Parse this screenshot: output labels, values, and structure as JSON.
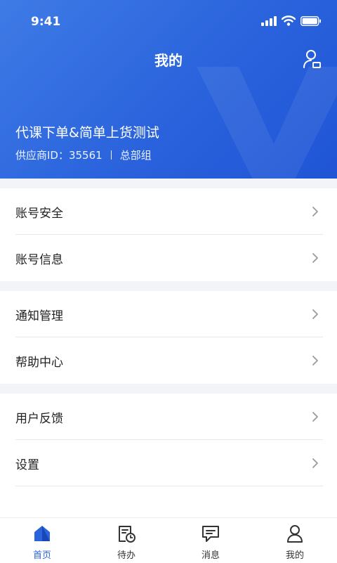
{
  "status_bar": {
    "time": "9:41"
  },
  "header": {
    "title": "我的",
    "company_name": "代课下单&简单上货测试",
    "supplier_id": "供应商ID：35561",
    "department": "总部组"
  },
  "menu": {
    "items": [
      {
        "label": "账号安全"
      },
      {
        "label": "账号信息"
      },
      {
        "label": "通知管理"
      },
      {
        "label": "帮助中心"
      },
      {
        "label": "用户反馈"
      },
      {
        "label": "设置"
      }
    ]
  },
  "tabbar": {
    "tabs": [
      {
        "label": "首页",
        "icon": "home-icon",
        "active": true
      },
      {
        "label": "待办",
        "icon": "todo-clock-icon",
        "active": false
      },
      {
        "label": "消息",
        "icon": "message-icon",
        "active": false
      },
      {
        "label": "我的",
        "icon": "user-icon",
        "active": false
      }
    ]
  },
  "colors": {
    "header_gradient_start": "#3f7be6",
    "header_gradient_end": "#1f55d6",
    "active_tab": "#2a63dc",
    "separator_gray": "#f2f4f7"
  }
}
